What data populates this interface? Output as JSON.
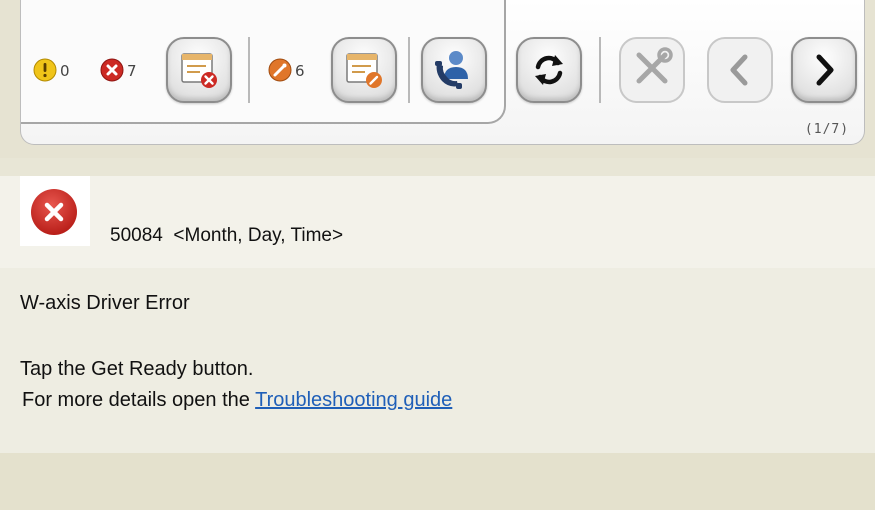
{
  "toolbar": {
    "warning_count": "0",
    "error_count": "7",
    "maintenance_count": "6",
    "page_indicator": "(1/7)",
    "colors": {
      "warning": "#f0c419",
      "error": "#cc2a24",
      "maintenance": "#e0762a"
    },
    "icons": [
      "warning-icon",
      "error-icon",
      "error-log-icon",
      "maintenance-icon",
      "maintenance-log-icon",
      "support-call-icon",
      "refresh-icon",
      "tools-icon",
      "previous-arrow-icon",
      "next-arrow-icon"
    ]
  },
  "error": {
    "code": "50084",
    "date_placeholder": "<Month, Day, Time>",
    "title": "W-axis Driver Error",
    "instruction": "Tap the Get Ready button.",
    "more_prefix": "For more details open the ",
    "link_text": "Troubleshooting guide",
    "link_color": "#1f5fb8"
  }
}
